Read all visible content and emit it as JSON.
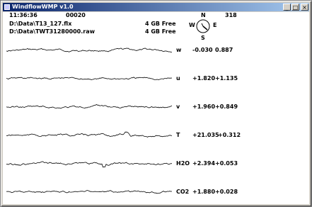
{
  "window": {
    "title": "WindflowWMP v1.0",
    "minimize_glyph": "_",
    "restore_glyph": "□",
    "close_glyph": "×"
  },
  "header": {
    "time": "11:36:36",
    "counter": "00020",
    "file1": "D:\\Data\\T13_127.flx",
    "file2": "D:\\Data\\TWT31280000.raw",
    "free1": "4 GB Free",
    "free2": "4 GB Free"
  },
  "compass": {
    "n": "N",
    "s": "S",
    "e": "E",
    "w": "W",
    "heading": "318"
  },
  "channels": [
    {
      "name": "w",
      "value": "-0.030",
      "sd": "0.887"
    },
    {
      "name": "u",
      "value": "+1.820",
      "sd": "+1.135"
    },
    {
      "name": "v",
      "value": "+1.960",
      "sd": "+0.849"
    },
    {
      "name": "T",
      "value": "+21.035",
      "sd": "+0.312"
    },
    {
      "name": "H2O",
      "value": "+2.394",
      "sd": "+0.053"
    },
    {
      "name": "CO2",
      "value": "+1.880",
      "sd": "+0.028"
    }
  ],
  "colors": {
    "title_start": "#0a246a",
    "title_end": "#a6caf0",
    "trace": "#000000"
  }
}
